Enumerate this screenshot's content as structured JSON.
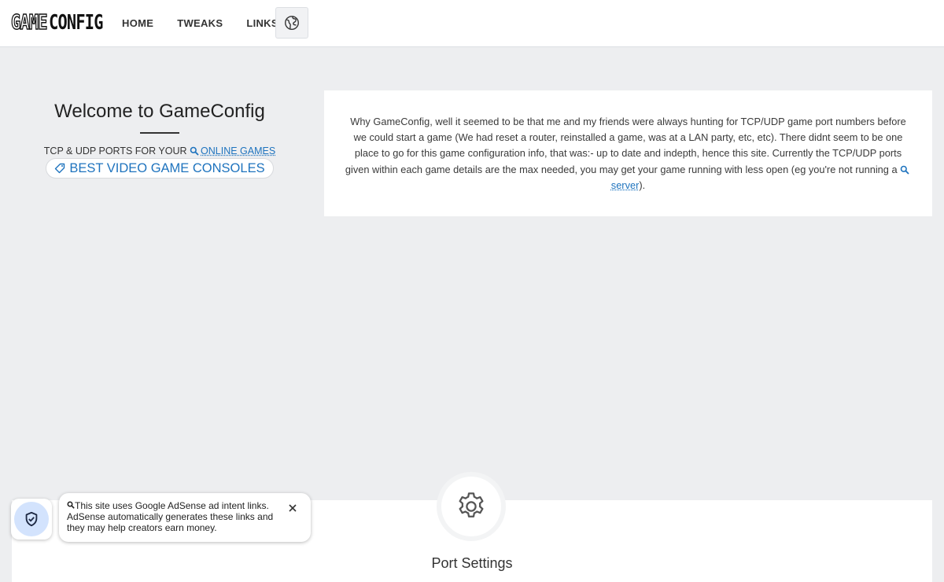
{
  "header": {
    "logo_part1": "GAME",
    "logo_part2": "CONFIG",
    "nav": [
      "HOME",
      "TWEAKS",
      "LINKS"
    ],
    "globe_icon": "globe-icon"
  },
  "welcome": {
    "title": "Welcome to GameConfig",
    "ports_prefix": "TCP & UDP PORTS FOR YOUR",
    "ports_link": "ONLINE GAMES",
    "consoles_link": "BEST VIDEO GAME CONSOLES"
  },
  "about": {
    "text_before": "Why GameConfig, well it seemed to be that me and my friends were always hunting for TCP/UDP game port numbers before we could start a game (We had reset a router, reinstalled a game, was at a LAN party, etc, etc). There didnt seem to be one place to go for this game configuration info, that was:- up to date and indepth, hence this site. Currently the TCP/UDP ports given within each game details are the max needed, you may get your game running with less open (eg you're not running a",
    "link": "server",
    "text_after": ")."
  },
  "port_settings": {
    "title": "Port Settings",
    "icon": "gear-icon"
  },
  "adsense_notice": {
    "text": "This site uses Google AdSense ad intent links. AdSense automatically generates these links and they may help creators earn money.",
    "icon": "shield-check-icon"
  },
  "colors": {
    "background": "#edeef0",
    "link": "#1e73be",
    "shield_bg": "#d3e3fd"
  }
}
